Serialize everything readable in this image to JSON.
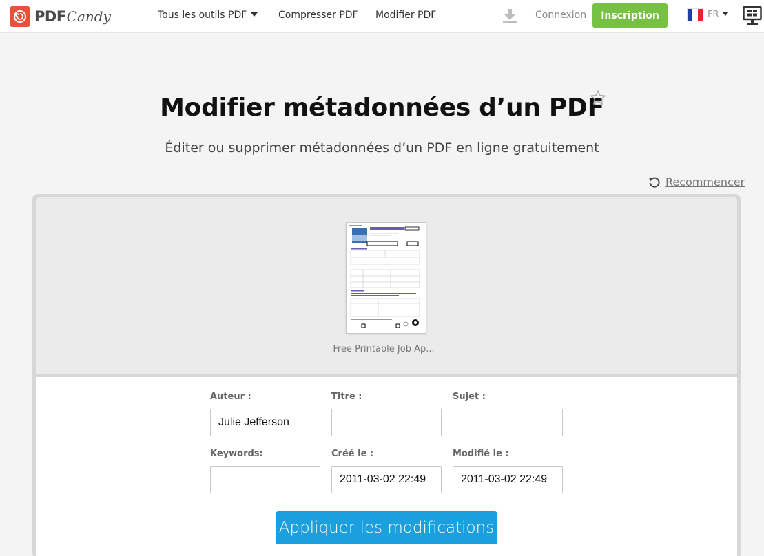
{
  "header": {
    "logo": {
      "pdf": "PDF",
      "candy": "Candy"
    },
    "nav": {
      "all_tools": "Tous les outils PDF",
      "compress": "Compresser PDF",
      "edit": "Modifier PDF"
    },
    "login": "Connexion",
    "signup": "Inscription",
    "language": "FR"
  },
  "main": {
    "title": "Modifier métadonnées d’un PDF",
    "subtitle": "Éditer ou supprimer métadonnées d’un PDF en ligne gratuitement",
    "restart": "Recommencer"
  },
  "file": {
    "name": "Free Printable Job Ap..."
  },
  "form": {
    "author_label": "Auteur :",
    "author_value": "Julie Jefferson",
    "title_label": "Titre :",
    "title_value": "",
    "subject_label": "Sujet :",
    "subject_value": "",
    "keywords_label": "Keywords:",
    "keywords_value": "",
    "created_label": "Créé le :",
    "created_value": "2011-03-02 22:49",
    "modified_label": "Modifié le :",
    "modified_value": "2011-03-02 22:49",
    "apply": "Appliquer les modifications"
  },
  "colors": {
    "brand": "#e8523b",
    "signup": "#76c043",
    "apply": "#1b9fde"
  }
}
